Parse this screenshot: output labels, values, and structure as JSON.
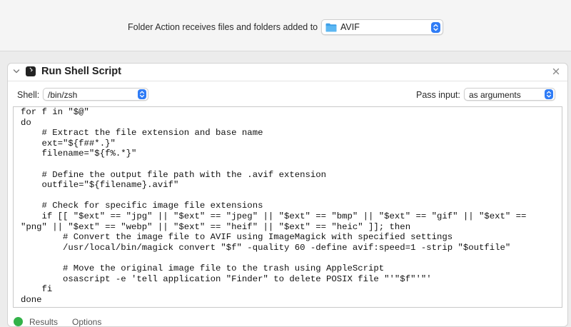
{
  "top": {
    "partial_text": "",
    "folder_action_label": "Folder Action receives files and folders added to",
    "folder_value": "AVIF",
    "accent_color": "#2f7cf6"
  },
  "action": {
    "title": "Run Shell Script",
    "shell_label": "Shell:",
    "shell_value": "/bin/zsh",
    "pass_input_label": "Pass input:",
    "pass_input_value": "as arguments",
    "script_lines": [
      "for f in \"$@\"",
      "do",
      "    # Extract the file extension and base name",
      "    ext=\"${f##*.}\"",
      "    filename=\"${f%.*}\"",
      "",
      "    # Define the output file path with the .avif extension",
      "    outfile=\"${filename}.avif\"",
      "",
      "    # Check for specific image file extensions",
      "    if [[ \"$ext\" == \"jpg\" || \"$ext\" == \"jpeg\" || \"$ext\" == \"bmp\" || \"$ext\" == \"gif\" || \"$ext\" ==",
      "\"png\" || \"$ext\" == \"webp\" || \"$ext\" == \"heif\" || \"$ext\" == \"heic\" ]]; then",
      "        # Convert the image file to AVIF using ImageMagick with specified settings",
      "        /usr/local/bin/magick convert \"$f\" -quality 60 -define avif:speed=1 -strip \"$outfile\"",
      "",
      "        # Move the original image file to the trash using AppleScript",
      "        osascript -e 'tell application \"Finder\" to delete POSIX file \"'\"$f\"'\"'",
      "    fi",
      "done"
    ],
    "tabs": {
      "results": "Results",
      "options": "Options"
    },
    "status_color": "#33b249"
  }
}
